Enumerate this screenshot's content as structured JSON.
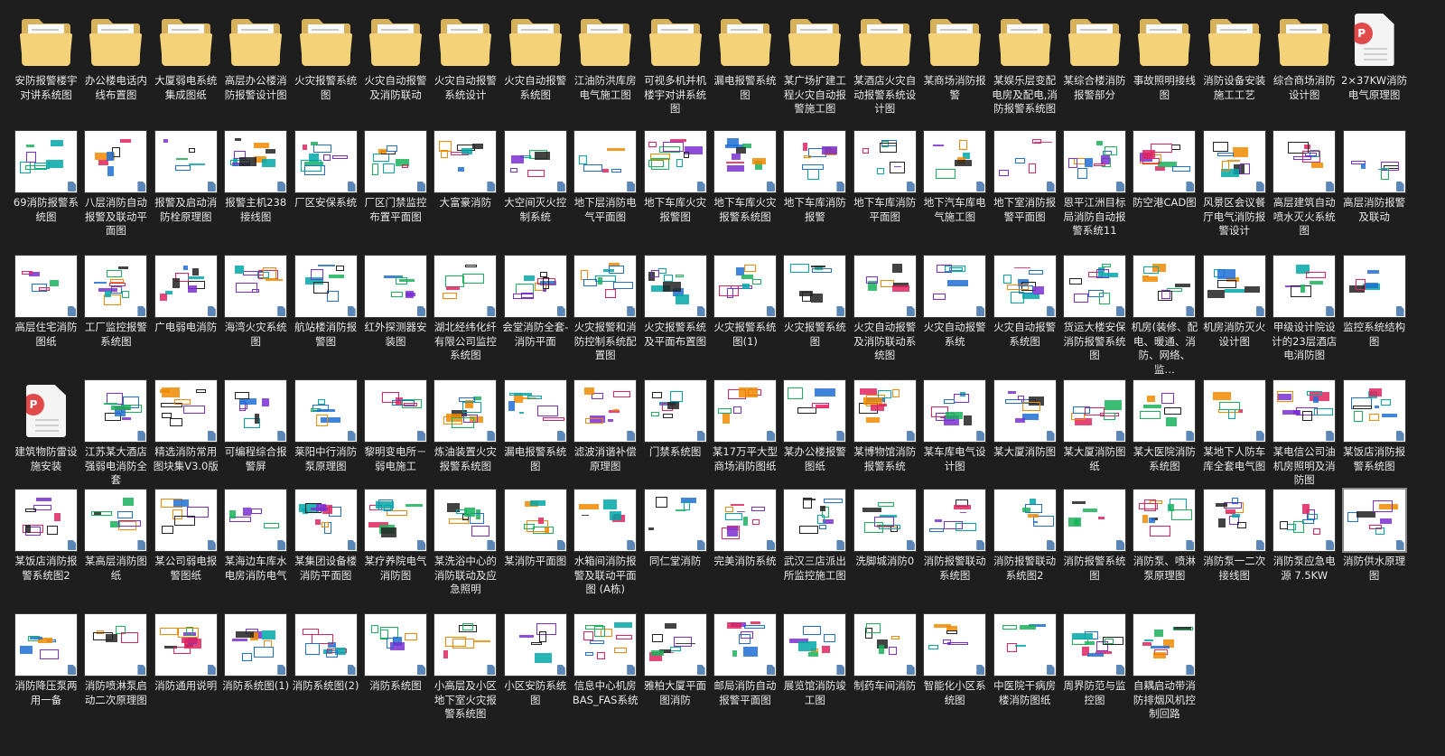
{
  "items": [
    {
      "label": "安防报警楼宇对讲系统图",
      "type": "folder"
    },
    {
      "label": "办公楼电话内线布置图",
      "type": "folder"
    },
    {
      "label": "大厦弱电系统集成图纸",
      "type": "folder"
    },
    {
      "label": "高层办公楼消防报警设计图",
      "type": "folder"
    },
    {
      "label": "火灾报警系统图",
      "type": "folder"
    },
    {
      "label": "火灾自动报警及消防联动",
      "type": "folder"
    },
    {
      "label": "火灾自动报警系统设计",
      "type": "folder"
    },
    {
      "label": "火灾自动报警系统图",
      "type": "folder"
    },
    {
      "label": "江油防洪库房电气施工图",
      "type": "folder"
    },
    {
      "label": "可视多机并机楼宇对讲系统图",
      "type": "folder"
    },
    {
      "label": "漏电报警系统图",
      "type": "folder"
    },
    {
      "label": "某广场扩建工程火灾自动报警施工图",
      "type": "folder"
    },
    {
      "label": "某酒店火灾自动报警系统设计图",
      "type": "folder"
    },
    {
      "label": "某商场消防报警",
      "type": "folder"
    },
    {
      "label": "某娱乐层变配电房及配电,消防报警系统图",
      "type": "folder"
    },
    {
      "label": "某综合楼消防报警部分",
      "type": "folder"
    },
    {
      "label": "事故照明接线图",
      "type": "folder"
    },
    {
      "label": "消防设备安装施工工艺",
      "type": "folder"
    },
    {
      "label": "综合商场消防设计图",
      "type": "folder"
    },
    {
      "label": "2×37KW消防电气原理图",
      "type": "pdf"
    },
    {
      "label": "69消防报警系统图",
      "type": "file"
    },
    {
      "label": "八层消防自动报警及联动平面图",
      "type": "file"
    },
    {
      "label": "报警及启动消防栓原理图",
      "type": "file"
    },
    {
      "label": "报警主机238接线图",
      "type": "file"
    },
    {
      "label": "厂区安保系统",
      "type": "file"
    },
    {
      "label": "厂区门禁监控布置平面图",
      "type": "file"
    },
    {
      "label": "大富豪消防",
      "type": "file"
    },
    {
      "label": "大空间灭火控制系统",
      "type": "file"
    },
    {
      "label": "地下层消防电气平面图",
      "type": "file"
    },
    {
      "label": "地下车库火灾报警图",
      "type": "file"
    },
    {
      "label": "地下车库火灾报警系统图",
      "type": "file"
    },
    {
      "label": "地下车库消防报警",
      "type": "file"
    },
    {
      "label": "地下车库消防平面图",
      "type": "file"
    },
    {
      "label": "地下汽车库电气施工图",
      "type": "file"
    },
    {
      "label": "地下室消防报警平面图",
      "type": "file"
    },
    {
      "label": "恩平江洲目标局消防自动报警系统11",
      "type": "file"
    },
    {
      "label": "防空港CAD图",
      "type": "file"
    },
    {
      "label": "风景区会议餐厅电气消防报警设计",
      "type": "file"
    },
    {
      "label": "高层建筑自动喷水灭火系统图",
      "type": "file"
    },
    {
      "label": "高层消防报警及联动",
      "type": "file"
    },
    {
      "label": "高层住宅消防图纸",
      "type": "file"
    },
    {
      "label": "工厂监控报警系统图",
      "type": "file"
    },
    {
      "label": "广电弱电消防",
      "type": "file"
    },
    {
      "label": "海湾火灾系统图",
      "type": "file"
    },
    {
      "label": "航站楼消防报警图",
      "type": "file"
    },
    {
      "label": "红外探测器安装图",
      "type": "file"
    },
    {
      "label": "湖北经纬化纤有限公司监控系统图",
      "type": "file"
    },
    {
      "label": "会堂消防全套-消防平面",
      "type": "file"
    },
    {
      "label": "火灾报警和消防控制系统配置图",
      "type": "file"
    },
    {
      "label": "火灾报警系统及平面布置图",
      "type": "file"
    },
    {
      "label": "火灾报警系统图(1)",
      "type": "file"
    },
    {
      "label": "火灾报警系统图",
      "type": "file"
    },
    {
      "label": "火灾自动报警及消防联动系统图",
      "type": "file"
    },
    {
      "label": "火灾自动报警系统",
      "type": "file"
    },
    {
      "label": "火灾自动报警系统图",
      "type": "file"
    },
    {
      "label": "货运大楼安保消防报警系统图",
      "type": "file"
    },
    {
      "label": "机房(装修、配电、暖通、消防、网络、监…",
      "type": "file"
    },
    {
      "label": "机房消防灭火设计图",
      "type": "file"
    },
    {
      "label": "甲级设计院设计的23层酒店电消防图",
      "type": "file"
    },
    {
      "label": "监控系统结构图",
      "type": "file"
    },
    {
      "label": "建筑物防雷设施安装",
      "type": "pdf"
    },
    {
      "label": "江苏某大酒店强弱电消防全套",
      "type": "file"
    },
    {
      "label": "精选消防常用图块集V3.0版",
      "type": "file"
    },
    {
      "label": "可编程综合报警屏",
      "type": "file"
    },
    {
      "label": "莱阳中行消防泵原理图",
      "type": "file"
    },
    {
      "label": "黎明变电所－弱电施工",
      "type": "file"
    },
    {
      "label": "炼油装置火灾报警系统图",
      "type": "file"
    },
    {
      "label": "漏电报警系统图",
      "type": "file"
    },
    {
      "label": "滤波消谐补偿原理图",
      "type": "file"
    },
    {
      "label": "门禁系统图",
      "type": "file"
    },
    {
      "label": "某17万平大型商场消防图纸",
      "type": "file"
    },
    {
      "label": "某办公楼报警图纸",
      "type": "file"
    },
    {
      "label": "某博物馆消防报警系统",
      "type": "file"
    },
    {
      "label": "某车库电气设计图",
      "type": "file"
    },
    {
      "label": "某大厦消防图",
      "type": "file"
    },
    {
      "label": "某大厦消防图纸",
      "type": "file"
    },
    {
      "label": "某大医院消防系统图",
      "type": "file"
    },
    {
      "label": "某地下人防车库全套电气图",
      "type": "file"
    },
    {
      "label": "某电信公司油机房照明及消防图",
      "type": "file"
    },
    {
      "label": "某饭店消防报警系统图",
      "type": "file"
    },
    {
      "label": "某饭店消防报警系统图2",
      "type": "file"
    },
    {
      "label": "某高层消防图纸",
      "type": "file"
    },
    {
      "label": "某公司弱电报警图纸",
      "type": "file"
    },
    {
      "label": "某海边车库水电房消防电气",
      "type": "file"
    },
    {
      "label": "某集团设备楼消防平面图",
      "type": "file"
    },
    {
      "label": "某疗养院电气消防图",
      "type": "file"
    },
    {
      "label": "某洗浴中心的消防联动及应急照明",
      "type": "file"
    },
    {
      "label": "某消防平面图",
      "type": "file"
    },
    {
      "label": "水箱间消防报警及联动平面图 (A栋)",
      "type": "file"
    },
    {
      "label": "同仁堂消防",
      "type": "file"
    },
    {
      "label": "完美消防系统",
      "type": "file"
    },
    {
      "label": "武汉三店派出所监控施工图",
      "type": "file"
    },
    {
      "label": "洗脚城消防0",
      "type": "file"
    },
    {
      "label": "消防报警联动系统图",
      "type": "file"
    },
    {
      "label": "消防报警联动系统图2",
      "type": "file"
    },
    {
      "label": "消防报警系统图",
      "type": "file"
    },
    {
      "label": "消防泵、喷淋泵原理图",
      "type": "file"
    },
    {
      "label": "消防泵一二次接线图",
      "type": "file"
    },
    {
      "label": "消防泵应急电源 7.5KW",
      "type": "file"
    },
    {
      "label": "消防供水原理图",
      "type": "file",
      "selected": true
    },
    {
      "label": "消防降压泵两用一备",
      "type": "file"
    },
    {
      "label": "消防喷淋泵启动二次原理图",
      "type": "file"
    },
    {
      "label": "消防通用说明",
      "type": "file"
    },
    {
      "label": "消防系统图(1)",
      "type": "file"
    },
    {
      "label": "消防系统图(2)",
      "type": "file"
    },
    {
      "label": "消防系统图",
      "type": "file"
    },
    {
      "label": "小高层及小区地下室火灾报警系统图",
      "type": "file"
    },
    {
      "label": "小区安防系统图",
      "type": "file"
    },
    {
      "label": "信息中心机房BAS_FAS系统",
      "type": "file"
    },
    {
      "label": "雅柏大厦平面图消防",
      "type": "file"
    },
    {
      "label": "邮局消防自动报警平面图",
      "type": "file"
    },
    {
      "label": "展览馆消防竣工图",
      "type": "file"
    },
    {
      "label": "制药车间消防",
      "type": "file"
    },
    {
      "label": "智能化小区系统图",
      "type": "file"
    },
    {
      "label": "中医院干病房楼消防图纸",
      "type": "file"
    },
    {
      "label": "周界防范与监控图",
      "type": "file"
    },
    {
      "label": "自耦启动带消防排烟风机控制回路",
      "type": "file"
    }
  ]
}
